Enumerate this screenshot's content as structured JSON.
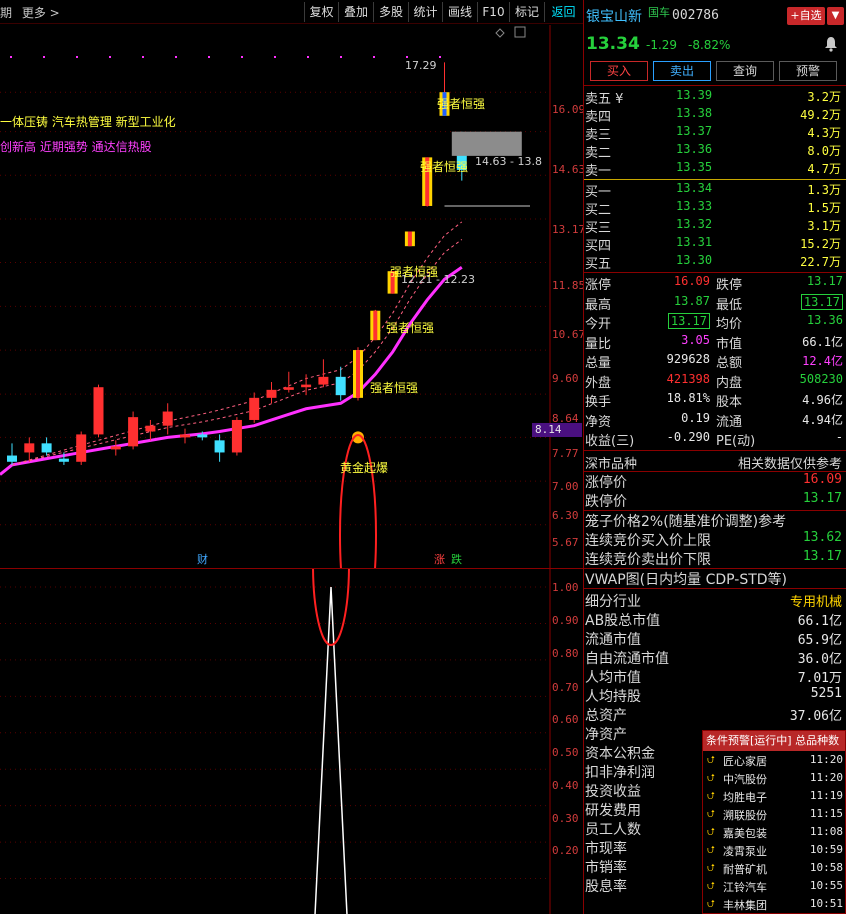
{
  "toolbar": {
    "left_items": [
      "期",
      "更多 >"
    ],
    "buttons": [
      "复权",
      "叠加",
      "多股",
      "统计",
      "画线",
      "F10",
      "标记",
      "返回"
    ]
  },
  "concepts": {
    "line1": "一体压铸 汽车热管理 新型工业化",
    "line2": "创新高 近期强势 通达信热股"
  },
  "main_chart": {
    "price_axis": [
      "16.09",
      "14.63",
      "13.17",
      "11.85",
      "10.67",
      "9.60",
      "8.64",
      "7.77",
      "7.00",
      "6.30",
      "5.67"
    ],
    "current_price_tag": "8.14",
    "high_note": "17.29",
    "range_note_1": "14.63 - 13.8",
    "range_note_2": "12.21 - 12.23",
    "signals": [
      "强者恒强",
      "强者恒强",
      "强者恒强",
      "强者恒强",
      "强者恒强"
    ],
    "golden_label": "黄金起爆",
    "markers": {
      "cai": "财",
      "zhang": "涨",
      "die": "跌"
    },
    "colors": {
      "up": "#ff3030",
      "down": "#40e0ff",
      "ma": "#ff30ff",
      "signal": "#ffd400"
    }
  },
  "chart_data": {
    "type": "candlestick",
    "title": "",
    "xlabel": "",
    "ylabel": "",
    "ylim": [
      5.4,
      17.6
    ],
    "candles": [
      {
        "o": 6.7,
        "h": 6.9,
        "l": 6.55,
        "c": 6.6
      },
      {
        "o": 6.75,
        "h": 7.0,
        "l": 6.6,
        "c": 6.9
      },
      {
        "o": 6.9,
        "h": 7.0,
        "l": 6.7,
        "c": 6.75
      },
      {
        "o": 6.65,
        "h": 6.75,
        "l": 6.55,
        "c": 6.6
      },
      {
        "o": 6.6,
        "h": 7.1,
        "l": 6.55,
        "c": 7.05
      },
      {
        "o": 7.05,
        "h": 7.95,
        "l": 7.0,
        "c": 7.9
      },
      {
        "o": 6.8,
        "h": 6.95,
        "l": 6.7,
        "c": 6.85
      },
      {
        "o": 6.85,
        "h": 7.45,
        "l": 6.8,
        "c": 7.35
      },
      {
        "o": 7.1,
        "h": 7.3,
        "l": 6.95,
        "c": 7.2
      },
      {
        "o": 7.2,
        "h": 7.6,
        "l": 7.05,
        "c": 7.45
      },
      {
        "o": 7.0,
        "h": 7.15,
        "l": 6.9,
        "c": 7.05
      },
      {
        "o": 7.05,
        "h": 7.1,
        "l": 6.95,
        "c": 7.0
      },
      {
        "o": 6.95,
        "h": 7.05,
        "l": 6.6,
        "c": 6.75
      },
      {
        "o": 6.75,
        "h": 7.35,
        "l": 6.7,
        "c": 7.3
      },
      {
        "o": 7.3,
        "h": 7.8,
        "l": 7.25,
        "c": 7.7
      },
      {
        "o": 7.7,
        "h": 8.0,
        "l": 7.6,
        "c": 7.85
      },
      {
        "o": 7.85,
        "h": 8.2,
        "l": 7.8,
        "c": 7.9
      },
      {
        "o": 7.9,
        "h": 8.15,
        "l": 7.75,
        "c": 7.95
      },
      {
        "o": 7.95,
        "h": 8.45,
        "l": 7.9,
        "c": 8.1
      },
      {
        "o": 8.1,
        "h": 8.3,
        "l": 7.65,
        "c": 7.75
      },
      {
        "o": 7.7,
        "h": 8.7,
        "l": 7.65,
        "c": 8.64
      },
      {
        "o": 8.85,
        "h": 9.52,
        "l": 8.85,
        "c": 9.5
      },
      {
        "o": 9.9,
        "h": 10.45,
        "l": 9.9,
        "c": 10.45
      },
      {
        "o": 11.1,
        "h": 11.5,
        "l": 11.1,
        "c": 11.5
      },
      {
        "o": 12.23,
        "h": 13.75,
        "l": 12.21,
        "c": 13.75
      },
      {
        "o": 15.2,
        "h": 17.29,
        "l": 15.2,
        "c": 16.09
      },
      {
        "o": 14.0,
        "h": 14.63,
        "l": 13.0,
        "c": 13.34
      }
    ],
    "ma": [
      6.55,
      6.6,
      6.65,
      6.7,
      6.75,
      6.8,
      6.85,
      6.9,
      6.95,
      7.0,
      7.03,
      7.06,
      7.1,
      7.15,
      7.2,
      7.3,
      7.4,
      7.5,
      7.55,
      7.6,
      7.8,
      8.15,
      8.6,
      9.2,
      9.75,
      10.25,
      10.55
    ]
  },
  "indicator": {
    "axis": [
      "1.00",
      "0.90",
      "0.80",
      "0.70",
      "0.60",
      "0.50",
      "0.40",
      "0.30",
      "0.20"
    ],
    "peak_value": 1.0
  },
  "stock": {
    "name": "银宝山新",
    "tag": "国车",
    "code": "002786",
    "add_label": "+自选",
    "drop_label": "▼",
    "price": "13.34",
    "change": "-1.29",
    "change_pct": "-8.82%"
  },
  "actions": [
    "买入",
    "卖出",
    "查询",
    "预警"
  ],
  "orderbook": {
    "asks": [
      {
        "label": "卖五 ¥",
        "price": "13.39",
        "vol": "3.2万"
      },
      {
        "label": "卖四",
        "price": "13.38",
        "vol": "49.2万"
      },
      {
        "label": "卖三",
        "price": "13.37",
        "vol": "4.3万"
      },
      {
        "label": "卖二",
        "price": "13.36",
        "vol": "8.0万"
      },
      {
        "label": "卖一",
        "price": "13.35",
        "vol": "4.7万"
      }
    ],
    "bids": [
      {
        "label": "买一",
        "price": "13.34",
        "vol": "1.3万"
      },
      {
        "label": "买二",
        "price": "13.33",
        "vol": "1.5万"
      },
      {
        "label": "买三",
        "price": "13.32",
        "vol": "3.1万"
      },
      {
        "label": "买四",
        "price": "13.31",
        "vol": "15.2万"
      },
      {
        "label": "买五",
        "price": "13.30",
        "vol": "22.7万"
      }
    ]
  },
  "stats": [
    {
      "l1": "涨停",
      "v1": "16.09",
      "c1": "#ff3030",
      "l2": "跌停",
      "v2": "13.17",
      "c2": "#26d03c"
    },
    {
      "l1": "最高",
      "v1": "13.87",
      "c1": "#26d03c",
      "l2": "最低",
      "v2": "13.17",
      "c2": "#26d03c",
      "box2": true
    },
    {
      "l1": "今开",
      "v1": "13.17",
      "c1": "#26d03c",
      "box1": true,
      "l2": "均价",
      "v2": "13.36",
      "c2": "#26d03c"
    },
    {
      "l1": "量比",
      "v1": "3.05",
      "c1": "#ff40ff",
      "l2": "市值",
      "v2": "66.1亿",
      "c2": "#e8e8e8"
    },
    {
      "l1": "总量",
      "v1": "929628",
      "c1": "#e8e8e8",
      "l2": "总额",
      "v2": "12.4亿",
      "c2": "#ff40ff"
    },
    {
      "l1": "外盘",
      "v1": "421398",
      "c1": "#ff3030",
      "l2": "内盘",
      "v2": "508230",
      "c2": "#26d03c"
    },
    {
      "l1": "换手",
      "v1": "18.81%",
      "c1": "#e8e8e8",
      "l2": "股本",
      "v2": "4.96亿",
      "c2": "#e8e8e8"
    },
    {
      "l1": "净资",
      "v1": "0.19",
      "c1": "#e8e8e8",
      "l2": "流通",
      "v2": "4.94亿",
      "c2": "#e8e8e8"
    },
    {
      "l1": "收益(三)",
      "v1": "-0.290",
      "c1": "#e8e8e8",
      "l2": "PE(动)",
      "v2": "-",
      "c2": "#e8e8e8"
    }
  ],
  "market": {
    "left": "深市品种",
    "right": "相关数据仅供参考",
    "rows": [
      {
        "k": "涨停价",
        "v": "16.09",
        "c": "#ff3030"
      },
      {
        "k": "跌停价",
        "v": "13.17",
        "c": "#26d03c"
      }
    ],
    "cage_title": "笼子价格2%(随基准价调整)参考",
    "cage_rows": [
      {
        "k": "连续竞价买入价上限",
        "v": "13.62",
        "c": "#26d03c"
      },
      {
        "k": "连续竞价卖出价下限",
        "v": "13.17",
        "c": "#26d03c"
      }
    ],
    "vwap_title": "VWAP图(日内均量 CDP-STD等)"
  },
  "fundamentals": [
    {
      "k": "细分行业",
      "v": "专用机械",
      "c": "#ffd400"
    },
    {
      "k": "AB股总市值",
      "v": "66.1亿",
      "c": "#e8e8e8"
    },
    {
      "k": "流通市值",
      "v": "65.9亿",
      "c": "#e8e8e8"
    },
    {
      "k": "自由流通市值",
      "v": "36.0亿",
      "c": "#e8e8e8"
    },
    {
      "k": "人均市值",
      "v": "7.01万",
      "c": "#e8e8e8"
    },
    {
      "k": "人均持股",
      "v": "5251",
      "c": "#e8e8e8"
    },
    {
      "k": "总资产",
      "v": "37.06亿",
      "c": "#e8e8e8"
    },
    {
      "k": "净资产",
      "v": "",
      "c": "#e8e8e8"
    },
    {
      "k": "资本公积金",
      "v": "",
      "c": "#e8e8e8"
    },
    {
      "k": "扣非净利润",
      "v": "",
      "c": "#e8e8e8"
    },
    {
      "k": "投资收益",
      "v": "",
      "c": "#e8e8e8"
    },
    {
      "k": "研发费用",
      "v": "",
      "c": "#e8e8e8"
    },
    {
      "k": "员工人数",
      "v": "",
      "c": "#e8e8e8"
    },
    {
      "k": "市现率",
      "v": "",
      "c": "#e8e8e8"
    },
    {
      "k": "市销率",
      "v": "",
      "c": "#e8e8e8"
    },
    {
      "k": "股息率",
      "v": "",
      "c": "#e8e8e8"
    }
  ],
  "alerts": {
    "title": "条件预警[运行中] 总品种数",
    "items": [
      {
        "name": "匠心家居",
        "time": "11:20"
      },
      {
        "name": "中汽股份",
        "time": "11:20"
      },
      {
        "name": "均胜电子",
        "time": "11:19"
      },
      {
        "name": "溯联股份",
        "time": "11:15"
      },
      {
        "name": "嘉美包装",
        "time": "11:08"
      },
      {
        "name": "凌霄泵业",
        "time": "10:59"
      },
      {
        "name": "耐普矿机",
        "time": "10:58"
      },
      {
        "name": "江铃汽车",
        "time": "10:55"
      },
      {
        "name": "丰林集团",
        "time": "10:51"
      }
    ]
  }
}
